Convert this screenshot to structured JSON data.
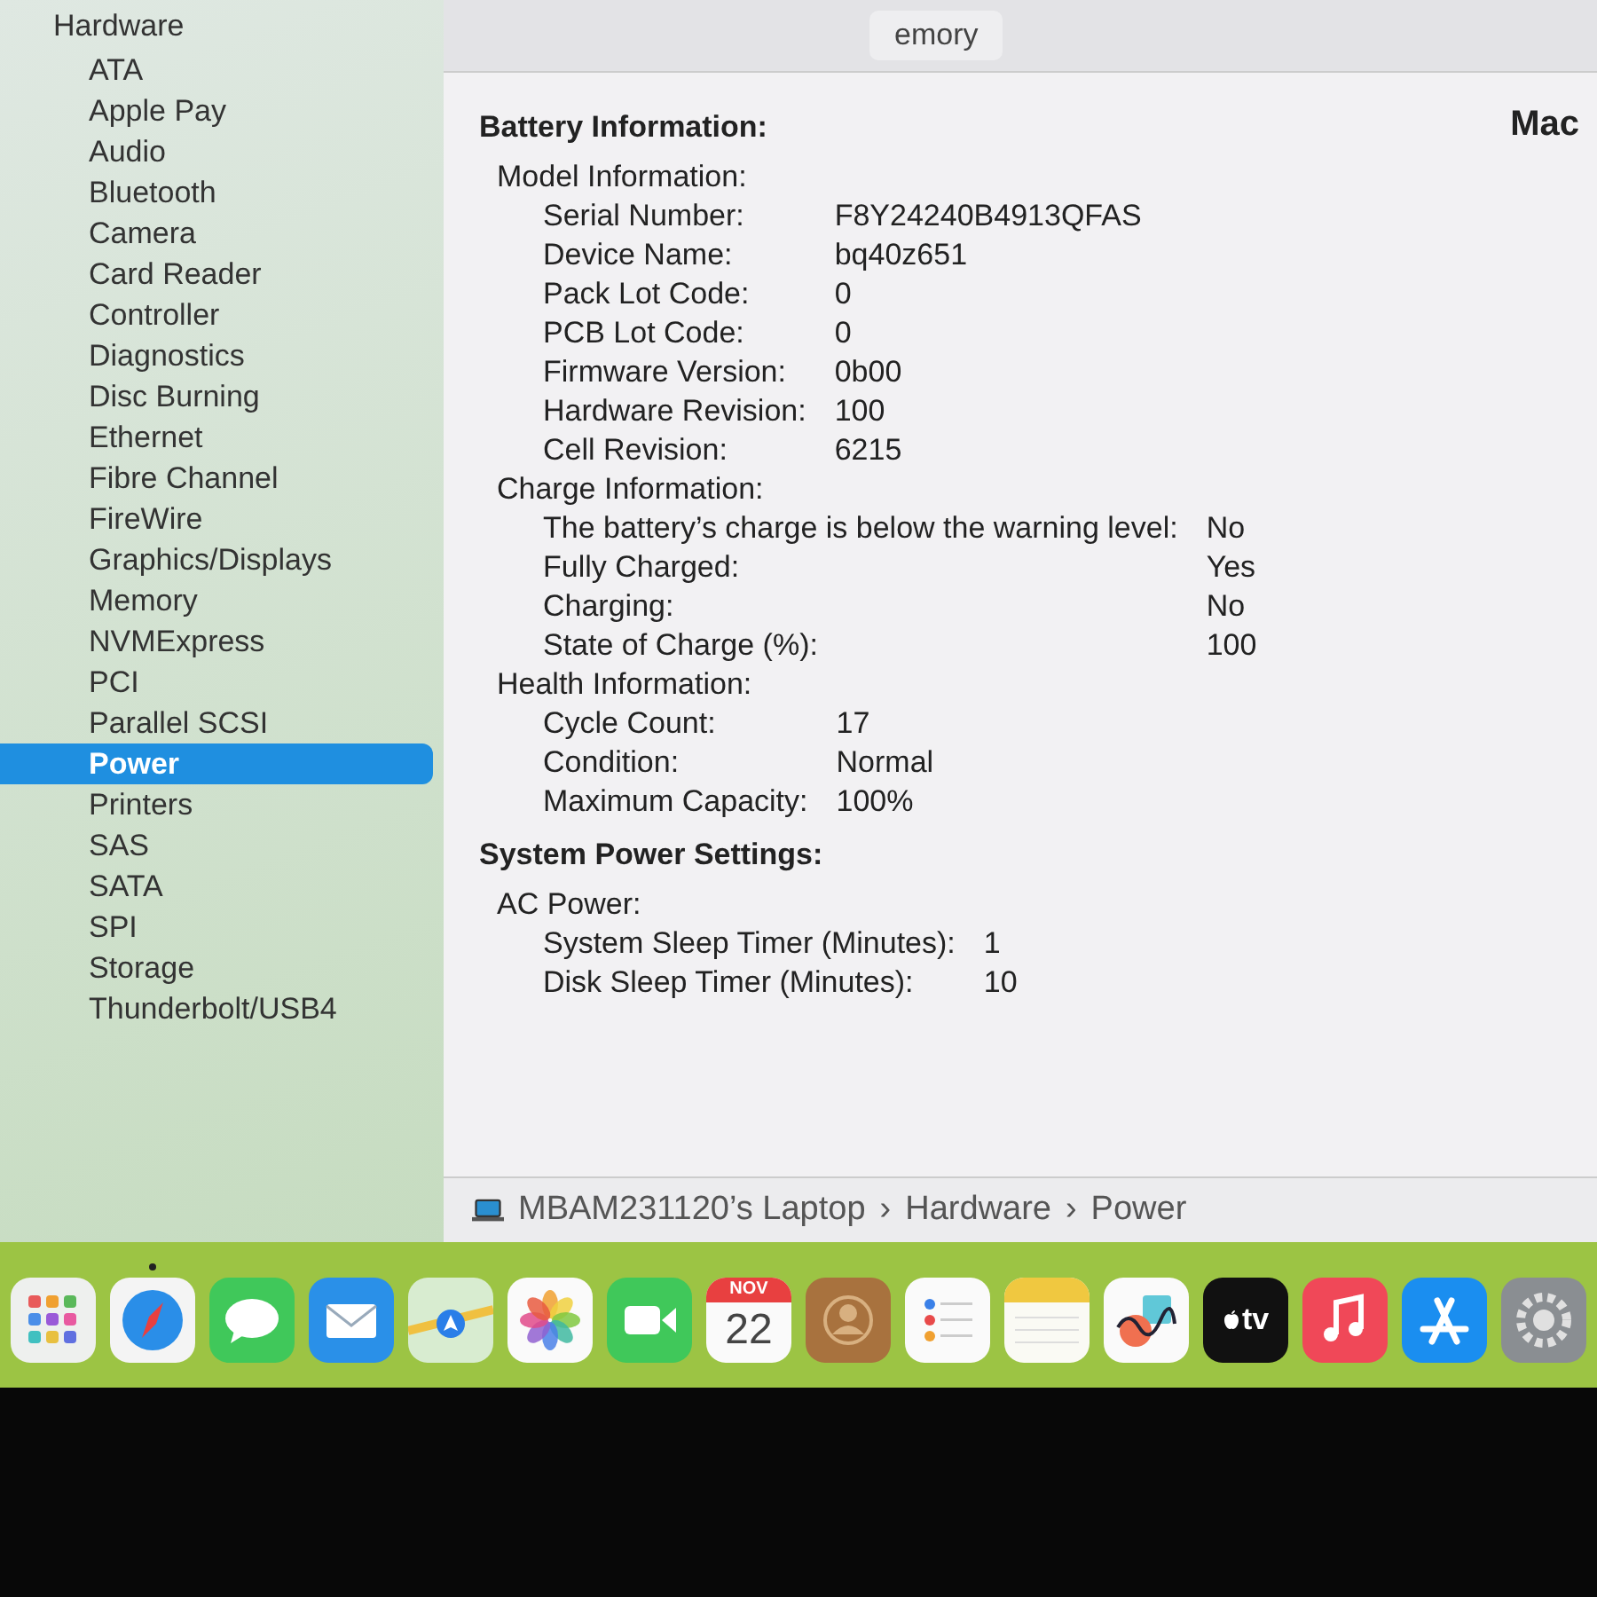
{
  "sidebar": {
    "group": "Hardware",
    "items": [
      {
        "label": "ATA",
        "selected": false
      },
      {
        "label": "Apple Pay",
        "selected": false
      },
      {
        "label": "Audio",
        "selected": false
      },
      {
        "label": "Bluetooth",
        "selected": false
      },
      {
        "label": "Camera",
        "selected": false
      },
      {
        "label": "Card Reader",
        "selected": false
      },
      {
        "label": "Controller",
        "selected": false
      },
      {
        "label": "Diagnostics",
        "selected": false
      },
      {
        "label": "Disc Burning",
        "selected": false
      },
      {
        "label": "Ethernet",
        "selected": false
      },
      {
        "label": "Fibre Channel",
        "selected": false
      },
      {
        "label": "FireWire",
        "selected": false
      },
      {
        "label": "Graphics/Displays",
        "selected": false
      },
      {
        "label": "Memory",
        "selected": false
      },
      {
        "label": "NVMExpress",
        "selected": false
      },
      {
        "label": "PCI",
        "selected": false
      },
      {
        "label": "Parallel SCSI",
        "selected": false
      },
      {
        "label": "Power",
        "selected": true
      },
      {
        "label": "Printers",
        "selected": false
      },
      {
        "label": "SAS",
        "selected": false
      },
      {
        "label": "SATA",
        "selected": false
      },
      {
        "label": "SPI",
        "selected": false
      },
      {
        "label": "Storage",
        "selected": false
      },
      {
        "label": "Thunderbolt/USB4",
        "selected": false
      }
    ]
  },
  "toolbar": {
    "segment": "emory"
  },
  "main_heading": "Mac",
  "sections": [
    {
      "title": "Battery Information:",
      "groups": [
        {
          "label": "Model Information:",
          "children": [
            {
              "label": "Serial Number:",
              "value": "F8Y24240B4913QFAS"
            },
            {
              "label": "Device Name:",
              "value": "bq40z651"
            },
            {
              "label": "Pack Lot Code:",
              "value": "0"
            },
            {
              "label": "PCB Lot Code:",
              "value": "0"
            },
            {
              "label": "Firmware Version:",
              "value": "0b00"
            },
            {
              "label": "Hardware Revision:",
              "value": "100"
            },
            {
              "label": "Cell Revision:",
              "value": "6215"
            }
          ]
        },
        {
          "label": "Charge Information:",
          "children": [
            {
              "label": "The battery’s charge is below the warning level:",
              "value": "No"
            },
            {
              "label": "Fully Charged:",
              "value": "Yes"
            },
            {
              "label": "Charging:",
              "value": "No"
            },
            {
              "label": "State of Charge (%):",
              "value": "100"
            }
          ]
        },
        {
          "label": "Health Information:",
          "children": [
            {
              "label": "Cycle Count:",
              "value": "17"
            },
            {
              "label": "Condition:",
              "value": "Normal"
            },
            {
              "label": "Maximum Capacity:",
              "value": "100%"
            }
          ]
        }
      ]
    },
    {
      "title": "System Power Settings:",
      "groups": [
        {
          "label": "AC Power:",
          "children": [
            {
              "label": "System Sleep Timer (Minutes):",
              "value": "1"
            },
            {
              "label": "Disk Sleep Timer (Minutes):",
              "value": "10"
            }
          ]
        }
      ]
    }
  ],
  "path_bar": {
    "separator": "›",
    "items": [
      "MBAM231120’s Laptop",
      "Hardware",
      "Power"
    ]
  },
  "dock": [
    {
      "kind": "launchpad",
      "running": false
    },
    {
      "kind": "safari",
      "running": true
    },
    {
      "kind": "messages",
      "running": false
    },
    {
      "kind": "mail",
      "running": false
    },
    {
      "kind": "maps",
      "running": false
    },
    {
      "kind": "photos",
      "running": false
    },
    {
      "kind": "facetime",
      "running": false
    },
    {
      "kind": "calendar",
      "running": false,
      "month": "NOV",
      "day": "22"
    },
    {
      "kind": "contacts",
      "running": false
    },
    {
      "kind": "reminders",
      "running": false
    },
    {
      "kind": "notes",
      "running": false
    },
    {
      "kind": "freeform",
      "running": false
    },
    {
      "kind": "tv",
      "running": false,
      "label": "tv"
    },
    {
      "kind": "music",
      "running": false
    },
    {
      "kind": "appstore",
      "running": false
    },
    {
      "kind": "settings",
      "running": false
    }
  ]
}
